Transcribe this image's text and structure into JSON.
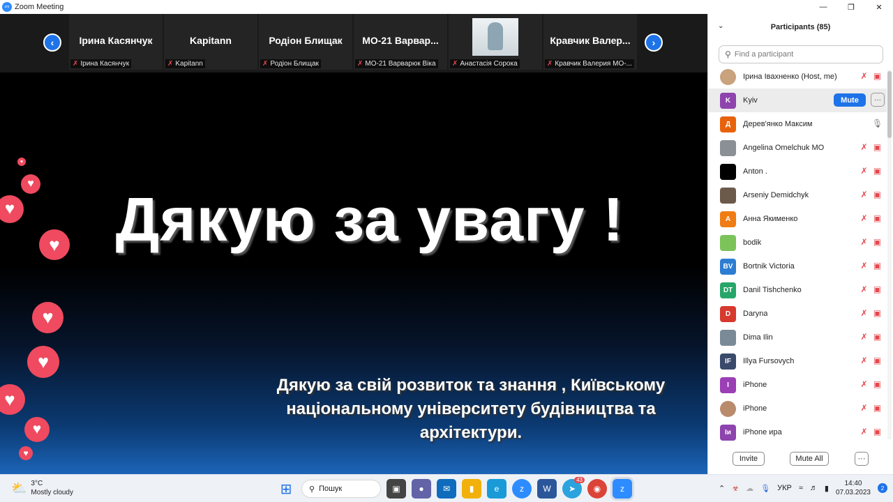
{
  "window": {
    "title": "Zoom Meeting"
  },
  "strip": {
    "tiles": [
      {
        "name": "Ірина Касянчук",
        "label": "Ірина Касянчук"
      },
      {
        "name": "Kapitann",
        "label": "Kapitann"
      },
      {
        "name": "Родіон Блищак",
        "label": "Родіон Блищак"
      },
      {
        "name": "МО-21 Варвар...",
        "label": "МО-21 Варварюк Віка"
      },
      {
        "name": "",
        "label": "Анастасія Сорока"
      },
      {
        "name": "Кравчик Валер...",
        "label": "Кравчик Валерия МО-..."
      }
    ]
  },
  "slide": {
    "title": "Дякую за увагу !",
    "subtitle_1": "Дякую за свій розвиток та знання , Київському",
    "subtitle_2": "національному університету будівництва та",
    "subtitle_3": "архітектури."
  },
  "participants": {
    "header": "Participants (85)",
    "search_placeholder": "Find a participant",
    "mute_label": "Mute",
    "invite_label": "Invite",
    "mute_all_label": "Mute All",
    "list": [
      {
        "initials": "",
        "name": "Ірина Івахненко (Host, me)",
        "color": "#c9a27e"
      },
      {
        "initials": "K",
        "name": "Kyiv",
        "color": "#8e44ad"
      },
      {
        "initials": "Д",
        "name": "Дерев'янко Максим",
        "color": "#e8620c"
      },
      {
        "initials": "",
        "name": "Angelina Omelchuk MO",
        "color": "#8b8f96"
      },
      {
        "initials": "",
        "name": "Anton .",
        "color": "#000000"
      },
      {
        "initials": "",
        "name": "Arseniy Demidchyk",
        "color": "#6b5a4a"
      },
      {
        "initials": "А",
        "name": "Анна Якименко",
        "color": "#f07c14"
      },
      {
        "initials": "",
        "name": "bodik",
        "color": "#7cc35a"
      },
      {
        "initials": "BV",
        "name": "Bortnik Victoria",
        "color": "#2d7dd2"
      },
      {
        "initials": "DT",
        "name": "Danil Tishchenko",
        "color": "#26a669"
      },
      {
        "initials": "D",
        "name": "Daryna",
        "color": "#d7392f"
      },
      {
        "initials": "",
        "name": "Dima Ilin",
        "color": "#7a8a96"
      },
      {
        "initials": "IF",
        "name": "Illya Fursovych",
        "color": "#3a4a6b"
      },
      {
        "initials": "I",
        "name": "iPhone",
        "color": "#9b3fb5"
      },
      {
        "initials": "",
        "name": "iPhone",
        "color": "#b88b6d"
      },
      {
        "initials": "Іи",
        "name": "iPhone ира",
        "color": "#8e44ad"
      }
    ]
  },
  "taskbar": {
    "temp": "3°C",
    "weather": "Mostly cloudy",
    "search": "Пошук",
    "telegram_badge": "43",
    "lang": "УКР",
    "time": "14:40",
    "date": "07.03.2023",
    "notif_count": "2"
  }
}
